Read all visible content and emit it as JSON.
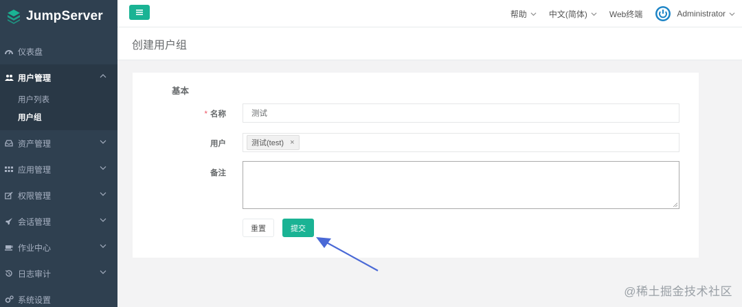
{
  "brand": {
    "name": "JumpServer"
  },
  "sidebar": {
    "items": [
      {
        "label": "仪表盘",
        "icon": "dashboard-icon"
      },
      {
        "label": "用户管理",
        "icon": "users-icon",
        "open": true,
        "children": [
          {
            "label": "用户列表"
          },
          {
            "label": "用户组",
            "active": true
          }
        ]
      },
      {
        "label": "资产管理",
        "icon": "inbox-icon"
      },
      {
        "label": "应用管理",
        "icon": "grid-icon"
      },
      {
        "label": "权限管理",
        "icon": "edit-icon"
      },
      {
        "label": "会话管理",
        "icon": "rocket-icon"
      },
      {
        "label": "作业中心",
        "icon": "coffee-icon"
      },
      {
        "label": "日志审计",
        "icon": "history-icon"
      },
      {
        "label": "系统设置",
        "icon": "gears-icon"
      }
    ]
  },
  "topbar": {
    "help": "帮助",
    "language": "中文(简体)",
    "terminal": "Web终端",
    "user": "Administrator"
  },
  "page": {
    "title": "创建用户组"
  },
  "form": {
    "section": "基本",
    "name_label": "名称",
    "name_required_mark": "*",
    "name_value": "测试",
    "users_label": "用户",
    "users_tag": "测试(test)",
    "users_tag_remove": "×",
    "comment_label": "备注",
    "comment_value": "",
    "reset_label": "重置",
    "submit_label": "提交"
  },
  "watermark": "@稀土掘金技术社区",
  "colors": {
    "sidebar": "#2f4050",
    "primary": "#1ab394",
    "arrow": "#4a69d6"
  }
}
